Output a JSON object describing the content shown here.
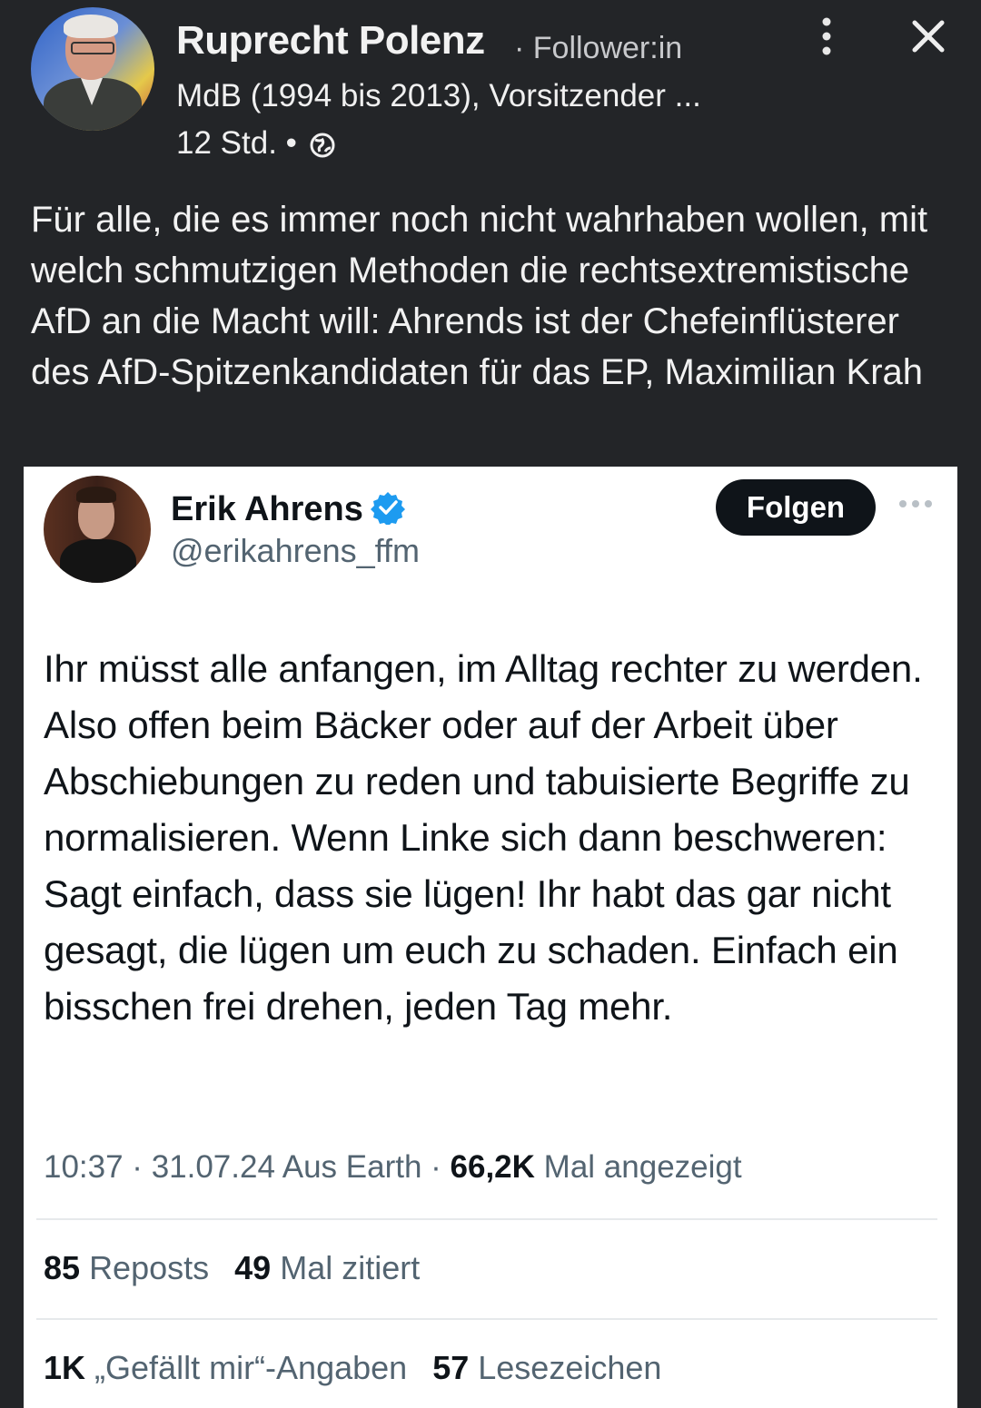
{
  "fb_post": {
    "author_name": "Ruprecht Polenz",
    "follower_label": "· Follower:in",
    "subtitle": "MdB (1994 bis 2013), Vorsitzender ...",
    "time": "12 Std. •",
    "text": "Für alle, die es immer noch nicht wahrhaben wollen, mit welch schmutzigen Methoden die rechtsextremistische AfD an die Macht will: Ahrends ist der Chefeinflüsterer des AfD-Spitzenkandidaten für das EP, Maximilian Krah"
  },
  "tweet": {
    "name": "Erik Ahrens",
    "handle": "@erikahrens_ffm",
    "follow_label": "Folgen",
    "text": "Ihr müsst alle anfangen, im Alltag rechter zu werden. Also offen beim Bäcker oder auf der Arbeit über Abschiebungen zu reden und tabuisierte Begriffe zu normalisieren. Wenn Linke sich dann beschweren: Sagt einfach, dass sie lügen! Ihr habt das gar nicht gesagt, die lügen um euch zu schaden. Einfach ein bisschen frei drehen, jeden Tag mehr.",
    "meta_time": "10:37 · 31.07.24 Aus Earth ·",
    "views_count": "66,2K",
    "views_label": "Mal angezeigt",
    "reposts_count": "85",
    "reposts_label": "Reposts",
    "quotes_count": "49",
    "quotes_label": "Mal zitiert",
    "likes_count": "1K",
    "likes_label": "„Gefällt mir“-Angaben",
    "bookmarks_count": "57",
    "bookmarks_label": "Lesezeichen"
  },
  "icons": {
    "globe": "globe-icon",
    "more": "more-vertical-icon",
    "close": "close-icon",
    "verified": "verified-badge-icon",
    "tweet_more": "more-horizontal-icon"
  },
  "colors": {
    "background": "#232528",
    "verified_blue": "#1d9bf0",
    "follow_button": "#0f1419"
  }
}
